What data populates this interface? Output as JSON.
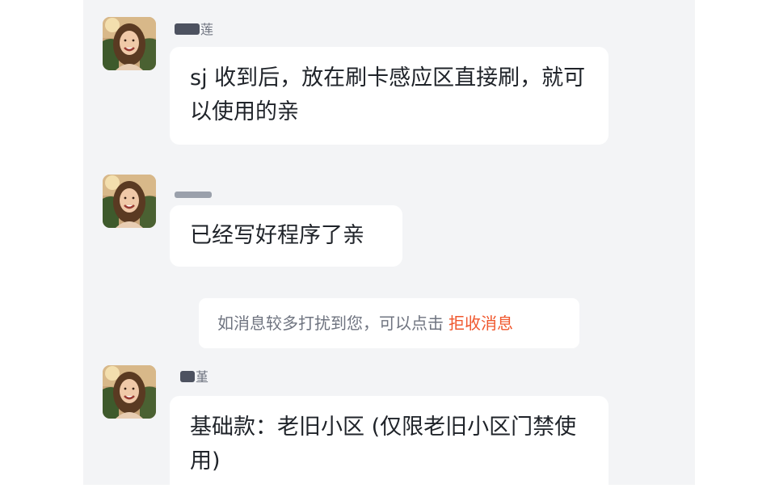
{
  "messages": [
    {
      "sender_partial": "莲",
      "text": "sj 收到后，放在刷卡感应区直接刷，就可以使用的亲"
    },
    {
      "sender_partial": "",
      "text": "已经写好程序了亲"
    },
    {
      "sender_partial": "堇",
      "text": "基础款：老旧小区 (仅限老旧小区门禁使用)"
    }
  ],
  "notice": {
    "text": "如消息较多打扰到您，可以点击",
    "link_label": "拒收消息"
  },
  "colors": {
    "panel_bg": "#f3f4f6",
    "bubble_bg": "#ffffff",
    "text": "#1f2329",
    "muted": "#6f7480",
    "link": "#f0572d"
  },
  "icons": [
    "avatar-photo"
  ]
}
